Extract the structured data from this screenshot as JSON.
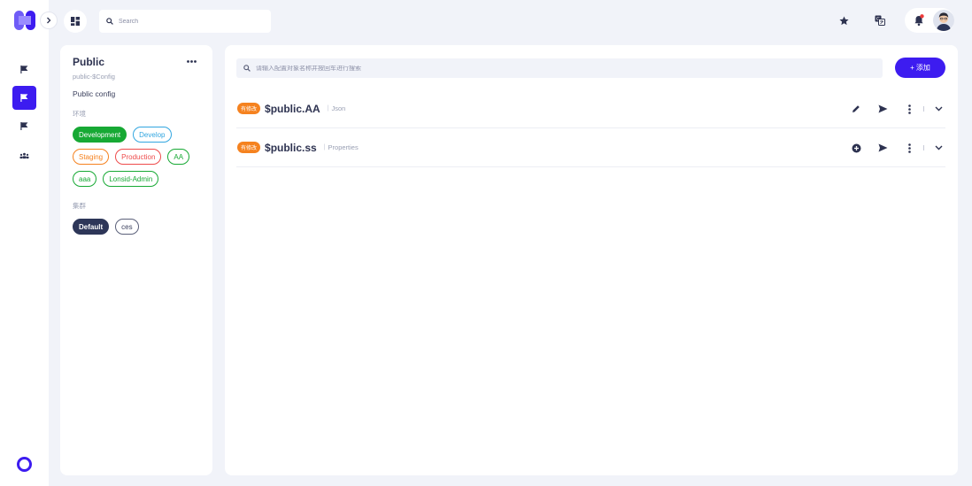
{
  "header": {
    "search_placeholder": "Search",
    "icons": [
      "expand-icon",
      "dashboard-icon",
      "search-icon",
      "star-icon",
      "translate-icon",
      "bell-icon",
      "avatar"
    ]
  },
  "sidebar": {
    "icons": [
      "flag-icon",
      "flag-icon",
      "flag-icon",
      "team-icon"
    ],
    "active_index": 1
  },
  "project": {
    "title": "Public",
    "subtitle": "public-$Config",
    "description": "Public config",
    "env_label": "环境",
    "environments": [
      {
        "label": "Development",
        "color": "#17a934",
        "selected": true
      },
      {
        "label": "Develop",
        "color": "#32a6e0",
        "selected": false
      },
      {
        "label": "Staging",
        "color": "#f5821f",
        "selected": false
      },
      {
        "label": "Production",
        "color": "#ee4b4b",
        "selected": false
      },
      {
        "label": "AA",
        "color": "#17a934",
        "selected": false
      },
      {
        "label": "aaa",
        "color": "#17a934",
        "selected": false
      },
      {
        "label": "Lonsid-Admin",
        "color": "#17a934",
        "selected": false
      }
    ],
    "cluster_label": "集群",
    "clusters": [
      {
        "label": "Default",
        "selected": true
      },
      {
        "label": "ces",
        "selected": false
      }
    ]
  },
  "main": {
    "search_placeholder": "请输入配置对象名称并按回车进行搜索",
    "add_label": "添加",
    "add_prefix": "+",
    "configs": [
      {
        "badge": "有修改",
        "name": "$public.AA",
        "type": "Json",
        "sep": "|",
        "first_action": "edit-icon"
      },
      {
        "badge": "有修改",
        "name": "$public.ss",
        "type": "Properties",
        "sep": "|",
        "first_action": "add-circle-icon"
      }
    ]
  },
  "colors": {
    "accent": "#3d1cf0",
    "badge": "#f5821f",
    "text": "#2d3250",
    "muted": "#9aa0b4",
    "cluster_selected": "#2d3658"
  }
}
